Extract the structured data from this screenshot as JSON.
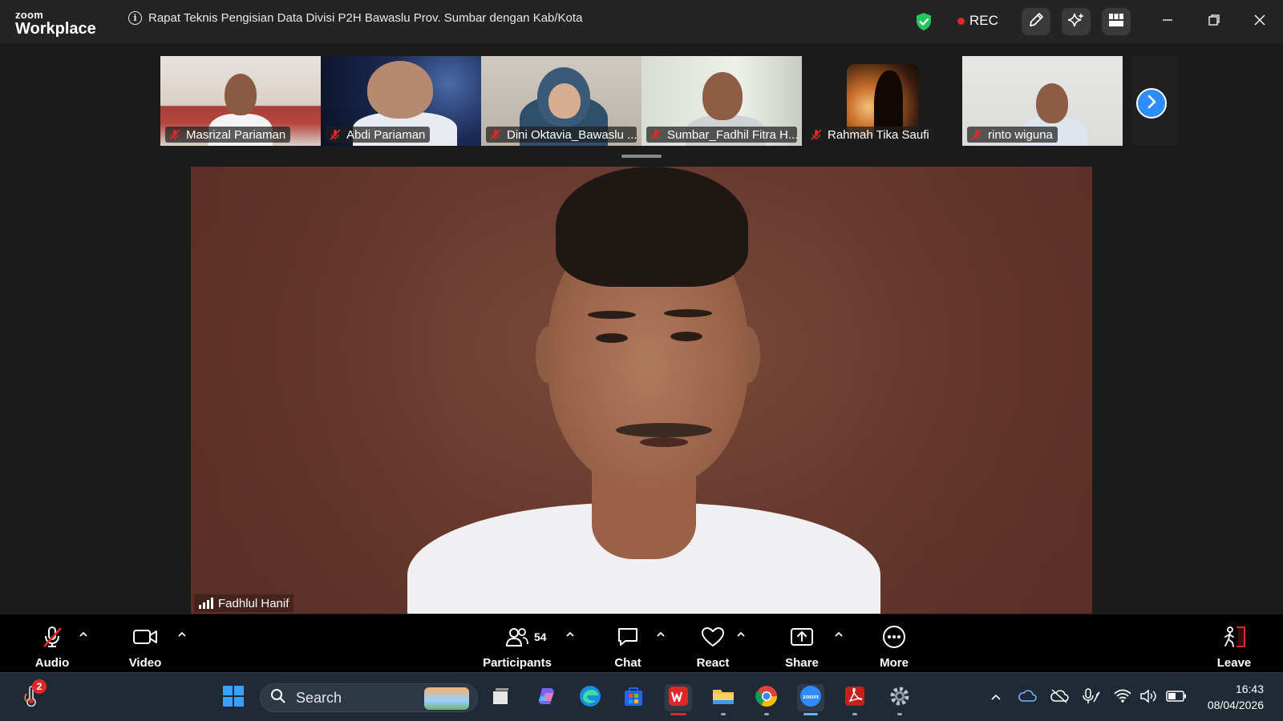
{
  "app": {
    "logo_line1": "zoom",
    "logo_line2": "Workplace",
    "meeting_title": "Rapat Teknis Pengisian Data Divisi P2H Bawaslu Prov. Sumbar dengan Kab/Kota",
    "rec_label": "REC"
  },
  "gallery": {
    "participants": [
      {
        "name": "Masrizal Pariaman",
        "muted": true
      },
      {
        "name": "Abdi Pariaman",
        "muted": true
      },
      {
        "name": "Dini Oktavia_Bawaslu ...",
        "muted": true
      },
      {
        "name": "Sumbar_Fadhil Fitra H...",
        "muted": true
      },
      {
        "name": "Rahmah Tika Saufi",
        "muted": true
      },
      {
        "name": "rinto wiguna",
        "muted": true
      }
    ]
  },
  "main_video": {
    "speaker_name": "Fadhlul Hanif"
  },
  "toolbar": {
    "audio": "Audio",
    "video": "Video",
    "participants": "Participants",
    "participant_count": "54",
    "chat": "Chat",
    "react": "React",
    "share": "Share",
    "more": "More",
    "leave": "Leave"
  },
  "taskbar": {
    "search_placeholder": "Search",
    "notification_count": "2",
    "time": "16:43",
    "date": "08/04/2026"
  },
  "colors": {
    "accent": "#2d8cff",
    "record_red": "#e02828",
    "shield_green": "#22c55e",
    "muted_red": "#e02828"
  }
}
